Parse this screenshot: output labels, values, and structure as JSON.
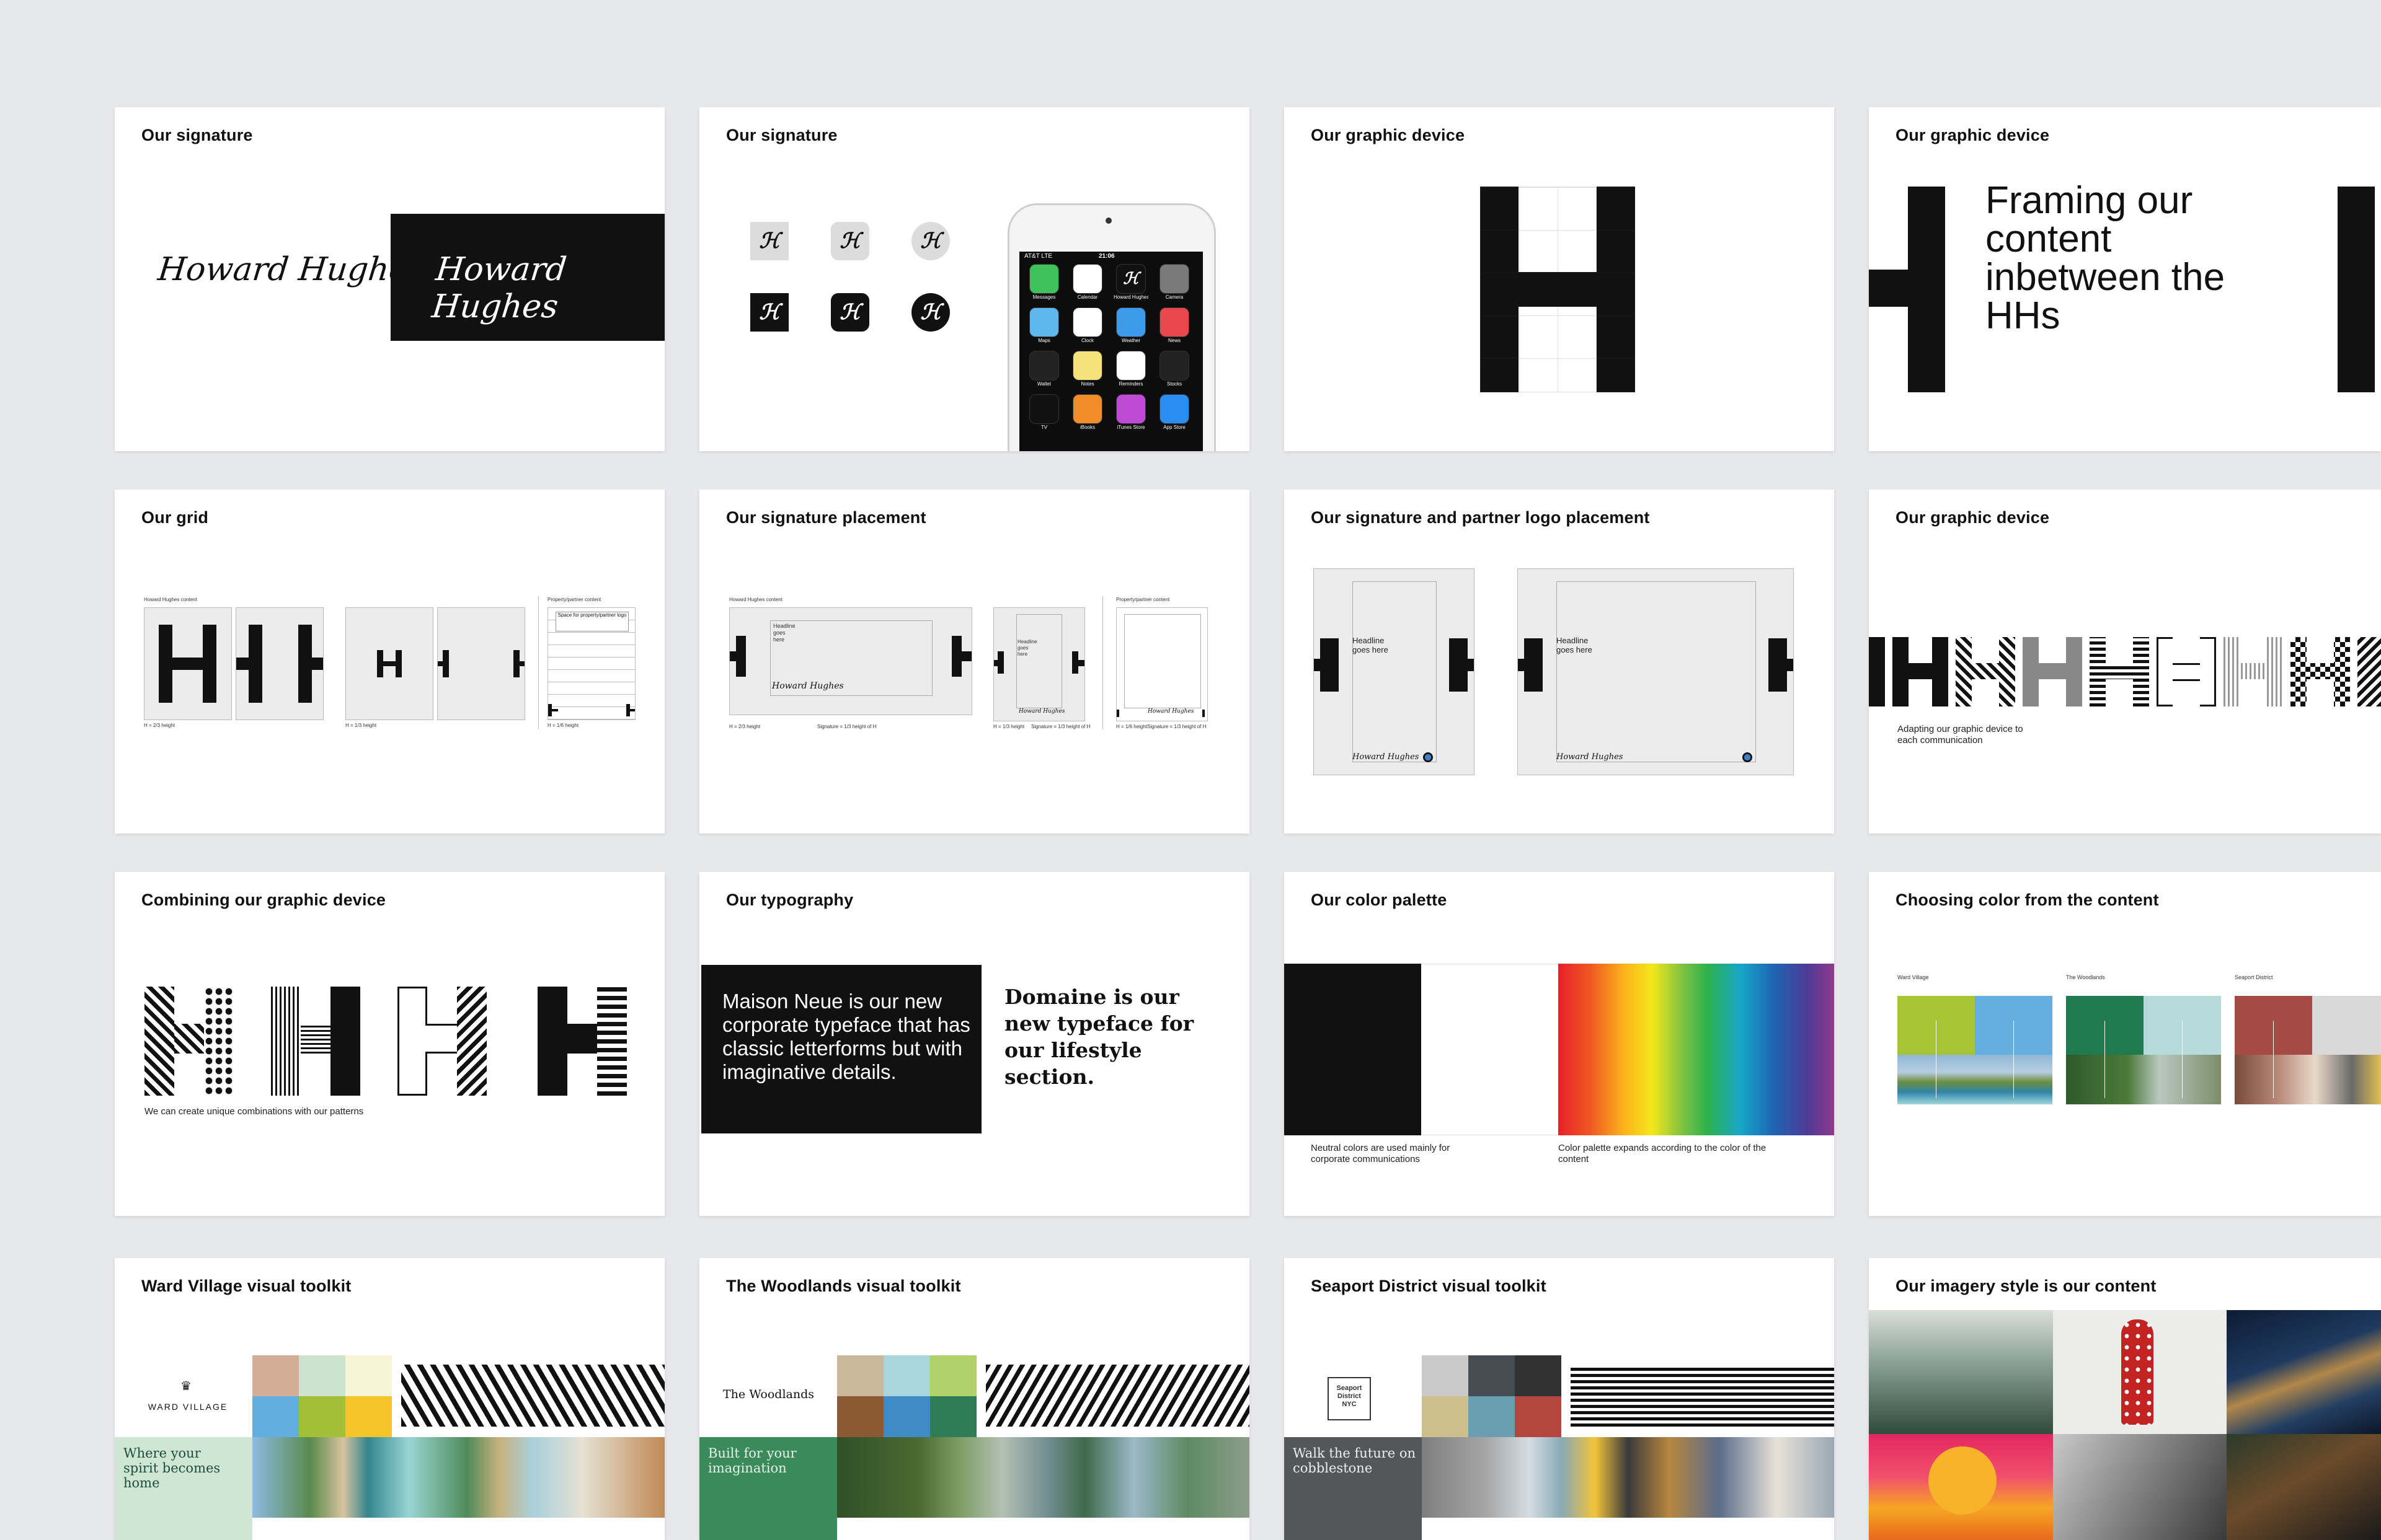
{
  "cards": {
    "c1": {
      "title": "Our signature",
      "signature": "Howard Hughes"
    },
    "c2": {
      "title": "Our signature",
      "phone": {
        "carrier": "AT&T LTE",
        "time": "21:06",
        "apps": [
          "Messages",
          "Calendar",
          "Howard Hughes",
          "Camera",
          "Maps",
          "Clock",
          "Weather",
          "News",
          "Wallet",
          "Notes",
          "Reminders",
          "Stocks",
          "TV",
          "iBooks",
          "iTunes Store",
          "App Store"
        ]
      }
    },
    "c3": {
      "title": "Our graphic device"
    },
    "c4": {
      "title": "Our graphic device",
      "headline": "Framing our content inbetween the HHs"
    },
    "c5": {
      "title": "Our grid",
      "label_left": "Howard Hughes content",
      "label_right": "Property/partner content",
      "logo_space": "Space for property/partner logo",
      "cap1": "H = 2/3 height",
      "cap2": "H = 1/3 height",
      "cap3": "H = 1/6 height"
    },
    "c6": {
      "title": "Our signature placement",
      "label_left": "Howard Hughes content",
      "label_right": "Property/partner content",
      "headline": "Headline goes here",
      "signature": "Howard Hughes",
      "cap1": "H = 2/3 height",
      "cap1b": "Signature = 1/3 height of H",
      "cap2": "H = 1/3 height",
      "cap2b": "Signature = 1/3 height of H",
      "cap3": "H = 1/6 height",
      "cap3b": "Signature = 1/3 height of H"
    },
    "c7": {
      "title": "Our signature and partner logo placement",
      "headline": "Headline goes here",
      "signature": "Howard Hughes"
    },
    "c8": {
      "title": "Our graphic device",
      "caption": "Adapting our graphic device to each communication"
    },
    "c9": {
      "title": "Combining our graphic device",
      "caption": "We can create unique combinations with our patterns"
    },
    "c10": {
      "title": "Our typography",
      "sans_text": "Maison Neue is our new corporate typeface that has classic letterforms but with imaginative details.",
      "serif_text": "Domaine is our new typeface for our lifestyle section."
    },
    "c11": {
      "title": "Our color palette",
      "caption_left": "Neutral colors are used mainly for corporate communications",
      "caption_right": "Color palette expands according to the color of the content"
    },
    "c12": {
      "title": "Choosing color from the content",
      "labels": [
        "Ward Village",
        "The Woodlands",
        "Seaport District"
      ]
    },
    "c13": {
      "title": "Ward Village visual toolkit",
      "logo": "WARD VILLAGE",
      "tagline": "Where your spirit becomes home"
    },
    "c14": {
      "title": "The Woodlands visual toolkit",
      "logo": "The Woodlands",
      "tagline": "Built for your imagination"
    },
    "c15": {
      "title": "Seaport District visual toolkit",
      "logo": "Seaport District NYC",
      "tagline": "Walk the future on cobblestone"
    },
    "c16": {
      "title": "Our imagery style is our content"
    }
  },
  "colors": {
    "background": "#e7e8e9",
    "black": "#111111",
    "ward_palette": [
      "#d3ad96",
      "#cde3cd",
      "#f7f5d6",
      "#63aee0",
      "#a2c035",
      "#f6c529"
    ],
    "woodlands_palette": [
      "#c9b99a",
      "#a9d6dc",
      "#b1d26a",
      "#8b5a34",
      "#3f8bc6",
      "#2f7c55"
    ],
    "seaport_palette": [
      "#c9c9c9",
      "#474c52",
      "#323232",
      "#cdbf8c",
      "#6a9fb1",
      "#b5463f"
    ],
    "ward_tagline_bg": "#cfe6d5",
    "woodlands_tagline_bg": "#3a8a5b",
    "seaport_tagline_bg": "#54575a"
  },
  "icons": [
    "hh-monogram-icon",
    "h-graphic-device-icon",
    "partner-logo-icon"
  ]
}
